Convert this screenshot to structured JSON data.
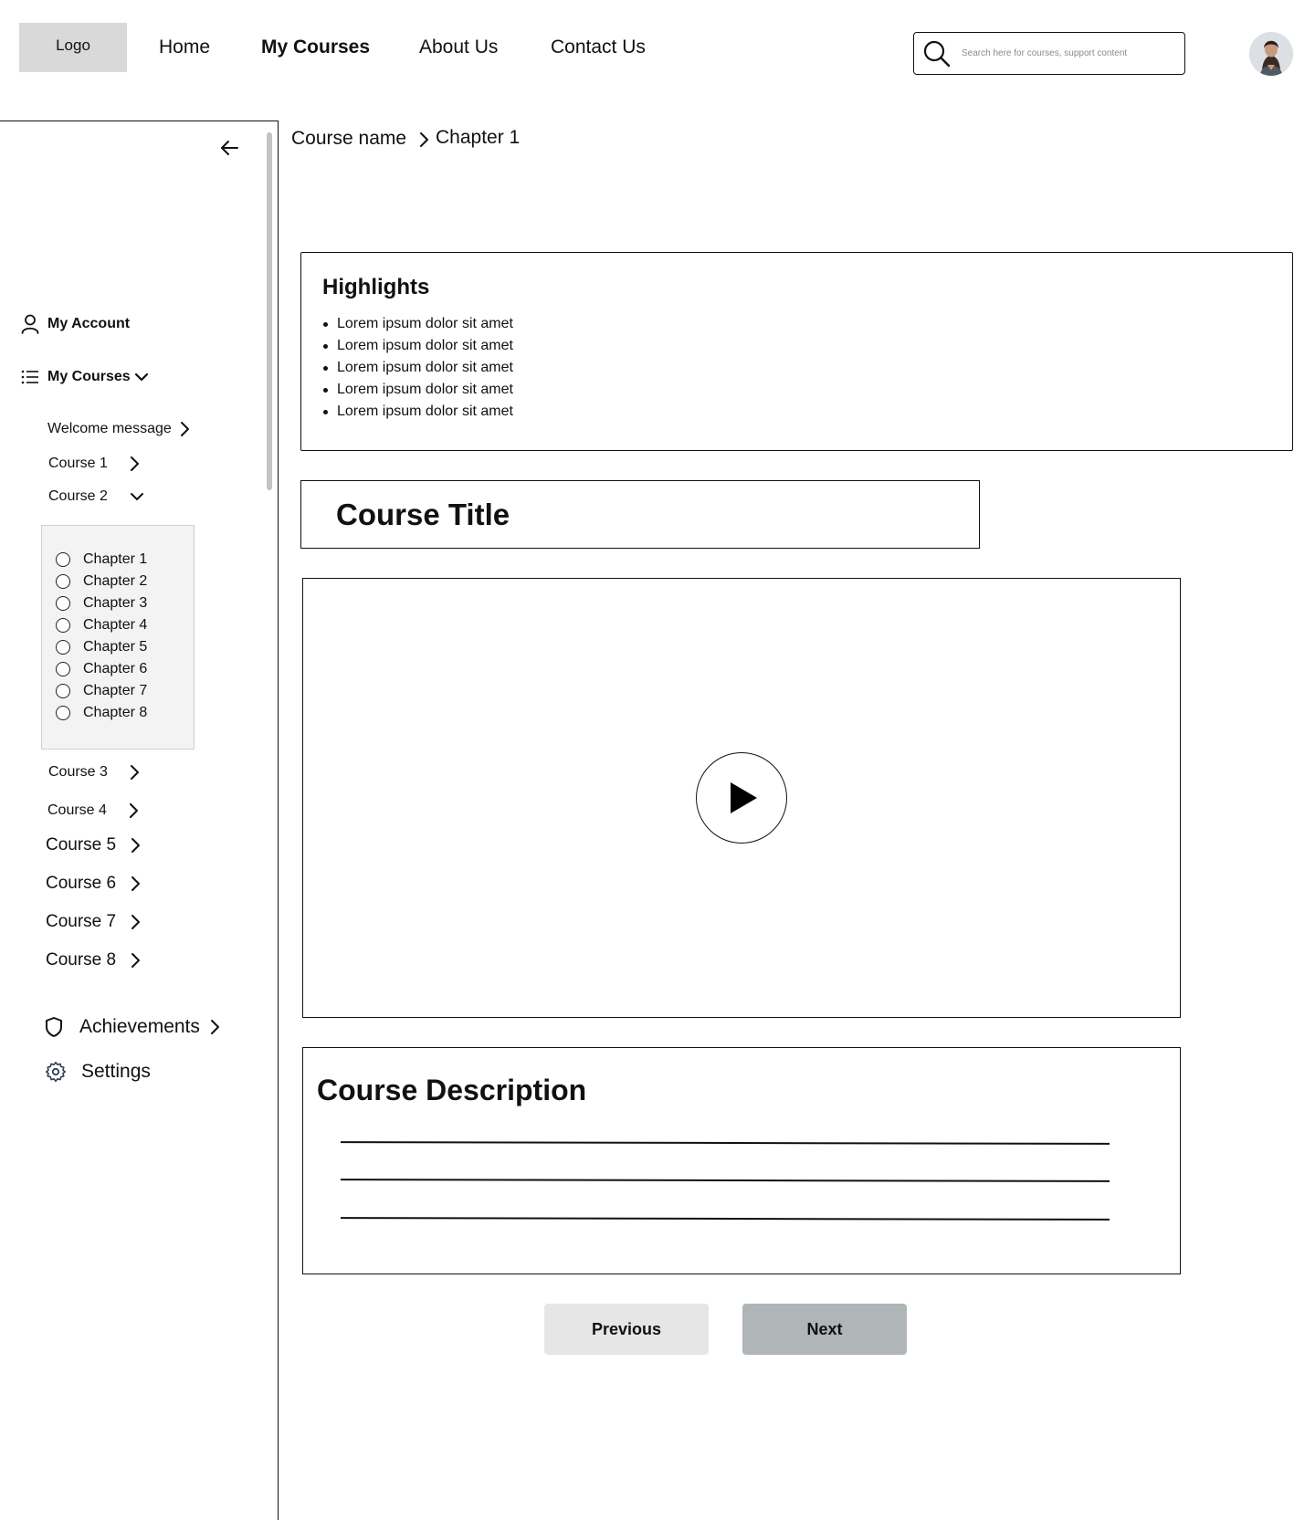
{
  "header": {
    "logo": "Logo",
    "nav": [
      "Home",
      "My Courses",
      "About Us",
      "Contact Us"
    ],
    "active_nav": "My Courses",
    "search_placeholder": "Search here for courses, support content"
  },
  "breadcrumb": {
    "course": "Course name",
    "chapter": "Chapter 1"
  },
  "sidebar": {
    "my_account": "My Account",
    "my_courses": "My Courses",
    "welcome": "Welcome message",
    "courses": [
      "Course 1",
      "Course 2",
      "Course 3",
      "Course 4",
      "Course 5",
      "Course 6",
      "Course 7",
      "Course 8"
    ],
    "chapters": [
      "Chapter 1",
      "Chapter 2",
      "Chapter 3",
      "Chapter 4",
      "Chapter 5",
      "Chapter 6",
      "Chapter 7",
      "Chapter 8"
    ],
    "achievements": "Achievements",
    "settings": "Settings"
  },
  "highlights": {
    "title": "Highlights",
    "items": [
      "Lorem ipsum dolor sit amet",
      "Lorem ipsum dolor sit amet",
      "Lorem ipsum dolor sit amet",
      "Lorem ipsum dolor sit amet",
      "Lorem ipsum dolor sit amet"
    ]
  },
  "course_title": "Course Title",
  "description": {
    "title": "Course Description"
  },
  "buttons": {
    "previous": "Previous",
    "next": "Next"
  },
  "icons": {
    "search": "search-icon",
    "back": "arrow-left-icon",
    "account": "user-icon",
    "courses": "list-icon",
    "achievements": "shield-icon",
    "settings": "gear-icon",
    "play": "play-icon"
  },
  "colors": {
    "logo_bg": "#d9d9d9",
    "previous_bg": "#e6e6e6",
    "next_bg": "#b0b5b8",
    "chapters_bg": "#f3f3f3"
  }
}
